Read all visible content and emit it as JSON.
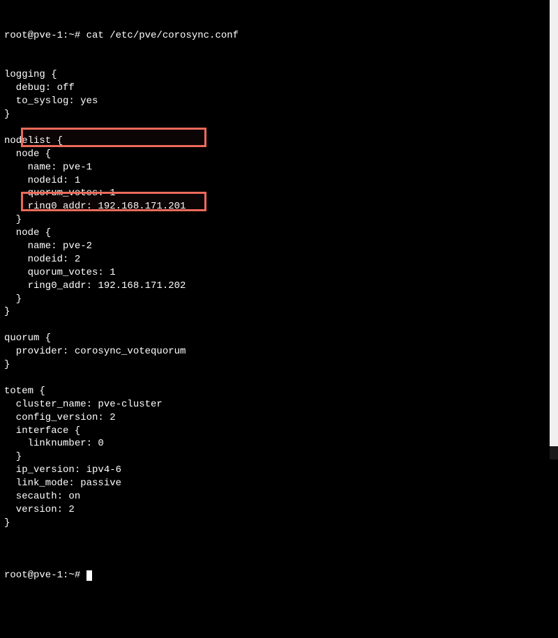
{
  "prompt1": "root@pve-1:~# cat /etc/pve/corosync.conf",
  "lines": [
    "logging {",
    "  debug: off",
    "  to_syslog: yes",
    "}",
    "",
    "nodelist {",
    "  node {",
    "    name: pve-1",
    "    nodeid: 1",
    "    quorum_votes: 1",
    "    ring0_addr: 192.168.171.201",
    "  }",
    "  node {",
    "    name: pve-2",
    "    nodeid: 2",
    "    quorum_votes: 1",
    "    ring0_addr: 192.168.171.202",
    "  }",
    "}",
    "",
    "quorum {",
    "  provider: corosync_votequorum",
    "}",
    "",
    "totem {",
    "  cluster_name: pve-cluster",
    "  config_version: 2",
    "  interface {",
    "    linknumber: 0",
    "  }",
    "  ip_version: ipv4-6",
    "  link_mode: passive",
    "  secauth: on",
    "  version: 2",
    "}",
    ""
  ],
  "prompt2": "root@pve-1:~# "
}
